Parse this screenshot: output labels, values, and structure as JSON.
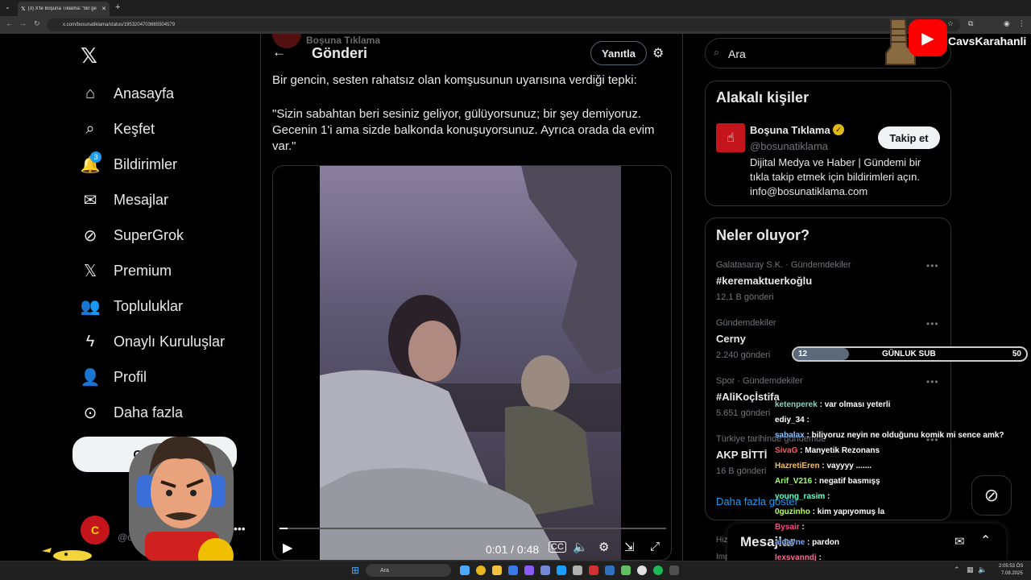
{
  "browser": {
    "tab_title": "(3) X'te Boşuna Tıklama: \"Bir ge",
    "url": "x.com/bosunatiklama/status/1953204703665504579"
  },
  "nav": {
    "items": [
      {
        "label": "Anasayfa",
        "icon": "home-icon"
      },
      {
        "label": "Keşfet",
        "icon": "search-icon"
      },
      {
        "label": "Bildirimler",
        "icon": "bell-icon",
        "badge": "3"
      },
      {
        "label": "Mesajlar",
        "icon": "mail-icon"
      },
      {
        "label": "SuperGrok",
        "icon": "grok-icon"
      },
      {
        "label": "Premium",
        "icon": "x-logo-icon"
      },
      {
        "label": "Topluluklar",
        "icon": "people-icon"
      },
      {
        "label": "Onaylı Kuruluşlar",
        "icon": "lightning-icon"
      },
      {
        "label": "Profil",
        "icon": "person-icon"
      },
      {
        "label": "Daha fazla",
        "icon": "more-circle-icon"
      }
    ],
    "post_button": "Gönder",
    "account_initial": "C",
    "account_handle": "@c"
  },
  "post": {
    "header_title": "Gönderi",
    "author_overlay": "Boşuna Tıklama",
    "reply_button": "Yanıtla",
    "text_1": "Bir gencin, sesten rahatsız olan komşusunun uyarısına verdiği tepki:",
    "text_2": "\"Sizin sabahtan beri sesiniz geliyor, gülüyorsunuz; bir şey demiyoruz. Gecenin 1'i ama sizde balkonda konuşuyorsunuz. Ayrıca orada da evim var.\"",
    "video": {
      "time": "0:01 / 0:48",
      "progress": 0.02
    }
  },
  "right": {
    "search_placeholder": "Ara",
    "related": {
      "title": "Alakalı kişiler",
      "name": "Boşuna Tıklama",
      "handle": "@bosunatiklama",
      "bio": "Dijital Medya ve Haber | Gündemi bir tıkla takip etmek için bildirimleri açın. info@bosunatiklama.com",
      "follow": "Takip et"
    },
    "trends": {
      "title": "Neler oluyor?",
      "items": [
        {
          "meta": "Galatasaray S.K. · Gündemdekiler",
          "name": "#keremaktuerkoğlu",
          "count": "12,1 B gönderi"
        },
        {
          "meta": "Gündemdekiler",
          "name": "Cerny",
          "count": "2.240 gönderi"
        },
        {
          "meta": "Spor · Gündemdekiler",
          "name": "#AliKoçİstifa",
          "count": "5.651 gönderi"
        },
        {
          "meta": "Türkiye tarihinde gündemde",
          "name": "AKP BİTTİ",
          "count": "16 B gönderi"
        }
      ],
      "show_more": "Daha fazla göster"
    },
    "footer_1": "Hizm",
    "footer_2": "Imp",
    "messages_label": "Mesajlar"
  },
  "stream": {
    "channel": "CavsKarahanli",
    "sub_goal": {
      "current": "12",
      "label": "GÜNLUK SUB",
      "target": "50",
      "progress": 0.24
    },
    "chat": [
      {
        "user": "ketenperek",
        "msg": "var olması yeterli",
        "color": "#8fd1c1"
      },
      {
        "user": "ediy_34",
        "msg": "",
        "color": "#ffffff"
      },
      {
        "user": "sabalax",
        "msg": "biliyoruz neyin ne olduğunu komik mi sence amk?",
        "color": "#8ec5ff"
      },
      {
        "user": "SivaG",
        "msg": "Manyetik Rezonans",
        "color": "#ff5a5a"
      },
      {
        "user": "HazretiEren",
        "msg": "vayyyy .......",
        "color": "#f0c060"
      },
      {
        "user": "Arif_V216",
        "msg": "negatif basmışş",
        "color": "#9cff6c"
      },
      {
        "user": "young_rasim",
        "msg": "",
        "color": "#6cffcf"
      },
      {
        "user": "0guzinho",
        "msg": "kim yapıyomuş la",
        "color": "#b4ff5a"
      },
      {
        "user": "Bysair",
        "msg": "",
        "color": "#ff4a8a"
      },
      {
        "user": "aidayne",
        "msg": "pardon",
        "color": "#7aa8ff"
      },
      {
        "user": "lexsvanndj",
        "msg": "",
        "color": "#ff6a9a"
      }
    ]
  },
  "taskbar": {
    "search": "Ara",
    "time": "2:05:53 ÖS",
    "date": "7.08.2025"
  }
}
